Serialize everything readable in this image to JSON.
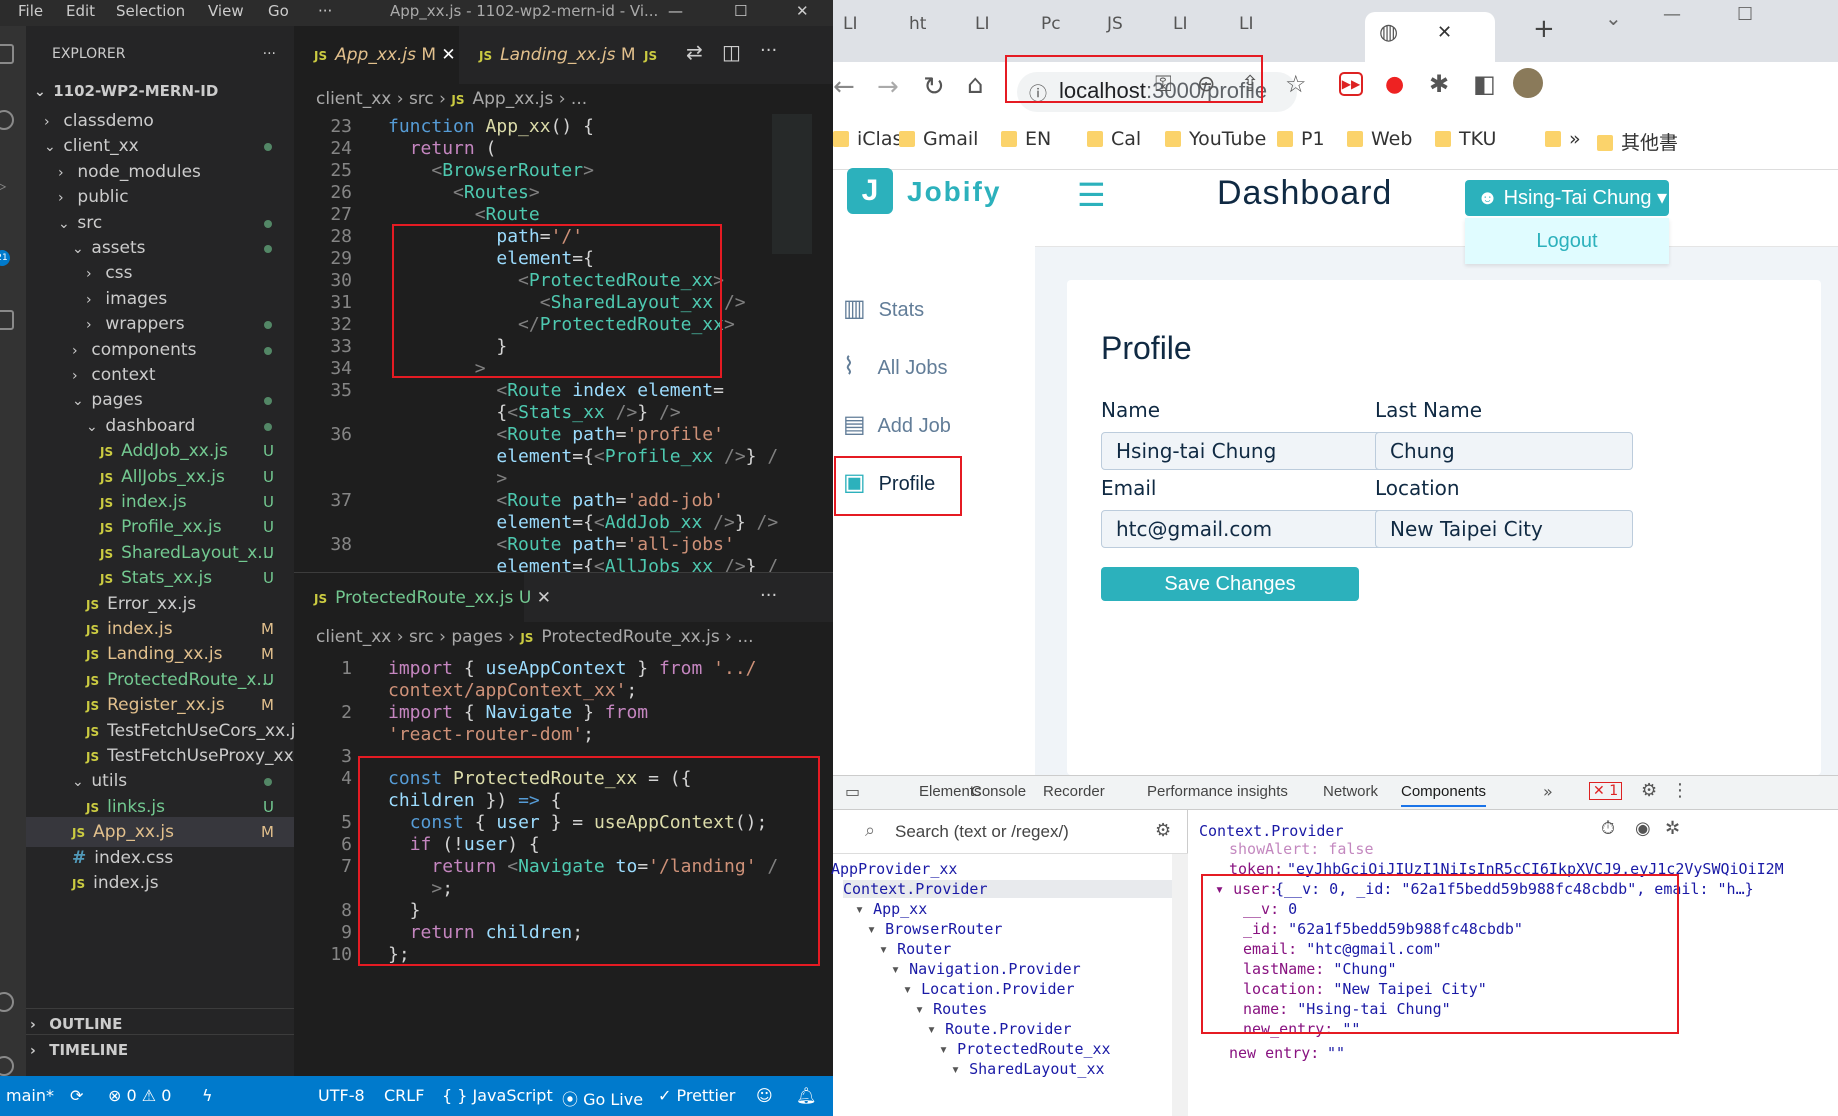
{
  "vscode": {
    "menu": [
      "File",
      "Edit",
      "Selection",
      "View",
      "Go",
      "···"
    ],
    "title": "App_xx.js - 1102-wp2-mern-id - Vi...",
    "explorer_title": "EXPLORER",
    "explorer_more": "···",
    "project": "1102-WP2-MERN-ID",
    "tree": [
      {
        "label": "classdemo",
        "kind": "folder",
        "open": false,
        "indent": 0,
        "status": ""
      },
      {
        "label": "client_xx",
        "kind": "folder",
        "open": true,
        "indent": 0,
        "status": "dot"
      },
      {
        "label": "node_modules",
        "kind": "folder",
        "open": false,
        "indent": 1,
        "status": ""
      },
      {
        "label": "public",
        "kind": "folder",
        "open": false,
        "indent": 1,
        "status": ""
      },
      {
        "label": "src",
        "kind": "folder",
        "open": true,
        "indent": 1,
        "status": "dot"
      },
      {
        "label": "assets",
        "kind": "folder",
        "open": true,
        "indent": 2,
        "status": "dot"
      },
      {
        "label": "css",
        "kind": "folder",
        "open": false,
        "indent": 3,
        "status": ""
      },
      {
        "label": "images",
        "kind": "folder",
        "open": false,
        "indent": 3,
        "status": ""
      },
      {
        "label": "wrappers",
        "kind": "folder",
        "open": false,
        "indent": 3,
        "status": "dot"
      },
      {
        "label": "components",
        "kind": "folder",
        "open": false,
        "indent": 2,
        "status": "dot"
      },
      {
        "label": "context",
        "kind": "folder",
        "open": false,
        "indent": 2,
        "status": ""
      },
      {
        "label": "pages",
        "kind": "folder",
        "open": true,
        "indent": 2,
        "status": "dot"
      },
      {
        "label": "dashboard",
        "kind": "folder",
        "open": true,
        "indent": 3,
        "status": "dot"
      },
      {
        "label": "AddJob_xx.js",
        "kind": "js",
        "indent": 4,
        "status": "U"
      },
      {
        "label": "AllJobs_xx.js",
        "kind": "js",
        "indent": 4,
        "status": "U"
      },
      {
        "label": "index.js",
        "kind": "js",
        "indent": 4,
        "status": "U"
      },
      {
        "label": "Profile_xx.js",
        "kind": "js",
        "indent": 4,
        "status": "U"
      },
      {
        "label": "SharedLayout_x...",
        "kind": "js",
        "indent": 4,
        "status": "U"
      },
      {
        "label": "Stats_xx.js",
        "kind": "js",
        "indent": 4,
        "status": "U"
      },
      {
        "label": "Error_xx.js",
        "kind": "js",
        "indent": 3,
        "status": ""
      },
      {
        "label": "index.js",
        "kind": "js",
        "indent": 3,
        "status": "M"
      },
      {
        "label": "Landing_xx.js",
        "kind": "js",
        "indent": 3,
        "status": "M"
      },
      {
        "label": "ProtectedRoute_x...",
        "kind": "js",
        "indent": 3,
        "status": "U"
      },
      {
        "label": "Register_xx.js",
        "kind": "js",
        "indent": 3,
        "status": "M"
      },
      {
        "label": "TestFetchUseCors_xx.js",
        "kind": "js",
        "indent": 3,
        "status": ""
      },
      {
        "label": "TestFetchUseProxy_xx.js",
        "kind": "js",
        "indent": 3,
        "status": ""
      },
      {
        "label": "utils",
        "kind": "folder",
        "open": true,
        "indent": 2,
        "status": "dot"
      },
      {
        "label": "links.js",
        "kind": "js",
        "indent": 3,
        "status": "U"
      },
      {
        "label": "App_xx.js",
        "kind": "js",
        "indent": 2,
        "status": "M",
        "selected": true
      },
      {
        "label": "index.css",
        "kind": "css",
        "indent": 2,
        "status": ""
      },
      {
        "label": "index.js",
        "kind": "js",
        "indent": 2,
        "status": ""
      }
    ],
    "outline": "OUTLINE",
    "timeline": "TIMELINE",
    "tabs": {
      "active": "App_xx.js",
      "active_status": "M",
      "second": "Landing_xx.js",
      "second_status": "M",
      "third": "JS",
      "more": "···",
      "lower": "ProtectedRoute_xx.js",
      "lower_status": "U",
      "lower_more": "···"
    },
    "breadcrumb_top": [
      "client_xx",
      "src",
      "App_xx.js",
      "..."
    ],
    "breadcrumb_bottom": [
      "client_xx",
      "src",
      "pages",
      "ProtectedRoute_xx.js",
      "..."
    ],
    "top_lines": [
      "23",
      "24",
      "25",
      "26",
      "27",
      "28",
      "29",
      "30",
      "31",
      "32",
      "33",
      "34",
      "35",
      "36",
      "37",
      "38"
    ],
    "bottom_lines": [
      "1",
      "2",
      "3",
      "4",
      "5",
      "6",
      "7",
      "8",
      "9",
      "10"
    ],
    "status": {
      "branch": "main*",
      "errors": "⊗ 0 ⚠ 0",
      "encoding": "UTF-8",
      "eol": "CRLF",
      "lang": "{ } JavaScript",
      "golive": "Go Live",
      "prettier": "✓ Prettier"
    }
  },
  "browser": {
    "tabs": [
      "LI",
      "ht",
      "LI",
      "Pc",
      "JS",
      "LI",
      "LI"
    ],
    "url_host": "localhost",
    "url_rest": ":3000/profile",
    "bookmarks": [
      "iClass",
      "Gmail",
      "EN",
      "Cal",
      "YouTube",
      "P1",
      "Web",
      "TKU",
      "»",
      "其他書"
    ],
    "app": {
      "logo_letter": "J",
      "logo_text": "Jobify",
      "heading": "Dashboard",
      "user_button": "Hsing-Tai Chung",
      "logout": "Logout",
      "nav": [
        "Stats",
        "All Jobs",
        "Add Job",
        "Profile"
      ],
      "profile_title": "Profile",
      "labels": {
        "name": "Name",
        "last_name": "Last Name",
        "email": "Email",
        "location": "Location"
      },
      "values": {
        "name": "Hsing-tai Chung",
        "last_name": "Chung",
        "email": "htc@gmail.com",
        "location": "New Taipei City"
      },
      "save": "Save Changes"
    },
    "devtools": {
      "tabs": [
        "Elements",
        "Console",
        "Recorder",
        "Performance insights",
        "Network",
        "Components"
      ],
      "badge": "1",
      "search": "Search (text or /regex/)",
      "selected": "Context.Provider",
      "tree": [
        "AppProvider_xx",
        "Context.Provider",
        "App_xx",
        "BrowserRouter",
        "Router",
        "Navigation.Provider",
        "Location.Provider",
        "Routes",
        "Route.Provider",
        "ProtectedRoute_xx",
        "SharedLayout_xx"
      ],
      "props": {
        "showAlert": "showAlert: false",
        "token_key": "token:",
        "token_val": "\"eyJhbGciOiJIUzI1NiIsInR5cCI6IkpXVCJ9.eyJ1c2VySWQiOiI2M",
        "user_key": "user:",
        "user_val": "{__v: 0, _id: \"62a1f5bedd59b988fc48cbdb\", email: \"h…}",
        "fields": [
          [
            "__v:",
            "0"
          ],
          [
            "_id:",
            "\"62a1f5bedd59b988fc48cbdb\""
          ],
          [
            "email:",
            "\"htc@gmail.com\""
          ],
          [
            "lastName:",
            "\"Chung\""
          ],
          [
            "location:",
            "\"New Taipei City\""
          ],
          [
            "name:",
            "\"Hsing-tai Chung\""
          ],
          [
            "new_entry:",
            "\"\""
          ]
        ],
        "new_entry_key": "new entry:",
        "new_entry_val": "\"\""
      }
    }
  }
}
